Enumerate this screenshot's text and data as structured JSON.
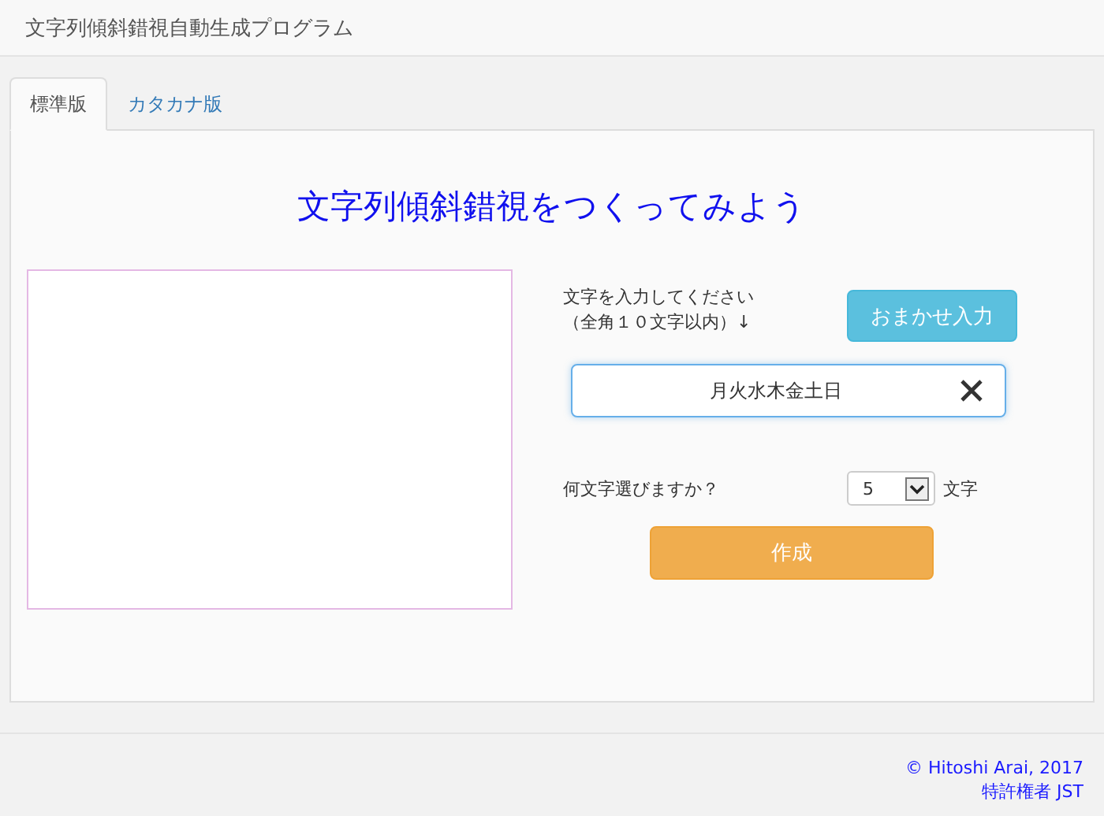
{
  "header": {
    "title": "文字列傾斜錯視自動生成プログラム"
  },
  "tabs": [
    {
      "label": "標準版",
      "selected": true
    },
    {
      "label": "カタカナ版",
      "selected": false
    }
  ],
  "main": {
    "heading": "文字列傾斜錯視をつくってみよう",
    "prompt_lines": [
      "文字を入力してください",
      "（全角１０文字以内）↓"
    ],
    "auto_button": "おまかせ入力",
    "text_input": {
      "value": "月火水木金土日"
    },
    "count_label": "何文字選びますか？",
    "count_select": {
      "value": "5"
    },
    "count_unit": "文字",
    "create_button": "作成"
  },
  "footer": {
    "copyright": "© Hitoshi Arai, 2017",
    "patent": "特許権者 JST"
  }
}
